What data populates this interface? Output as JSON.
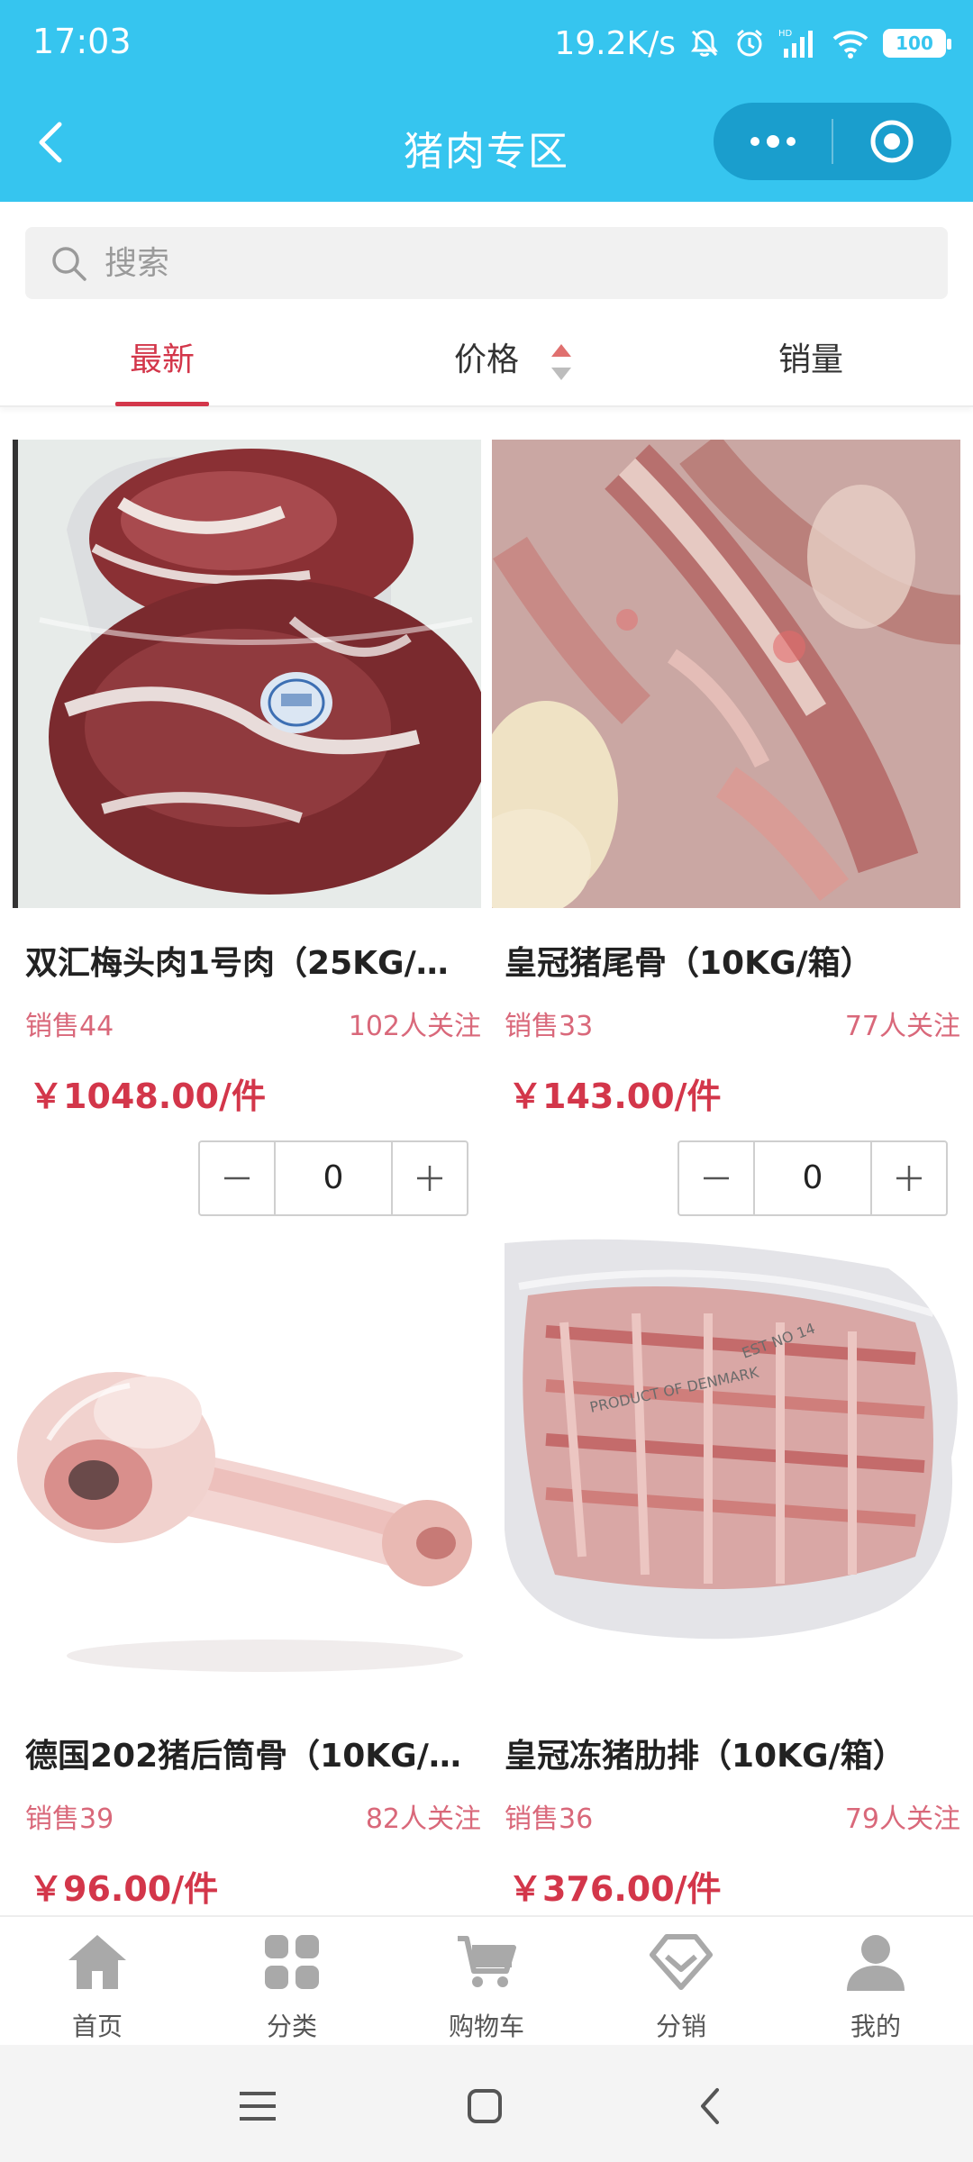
{
  "status": {
    "time": "17:03",
    "speed": "19.2K/s",
    "battery": "100"
  },
  "header": {
    "title": "猪肉专区"
  },
  "search": {
    "placeholder": "搜索"
  },
  "sort_tabs": {
    "latest": "最新",
    "price": "价格",
    "sales": "销量",
    "active": "最新"
  },
  "products": [
    {
      "name": "双汇梅头肉1号肉（25KG/…",
      "sold": "销售44",
      "followers": "102人关注",
      "price": "￥1048.00/件",
      "qty": "0"
    },
    {
      "name": "皇冠猪尾骨（10KG/箱）",
      "sold": "销售33",
      "followers": "77人关注",
      "price": "￥143.00/件",
      "qty": "0"
    },
    {
      "name": "德国202猪后筒骨（10KG/…",
      "sold": "销售39",
      "followers": "82人关注",
      "price": "￥96.00/件"
    },
    {
      "name": "皇冠冻猪肋排（10KG/箱）",
      "sold": "销售36",
      "followers": "79人关注",
      "price": "￥376.00/件"
    }
  ],
  "tabbar": {
    "home": "首页",
    "category": "分类",
    "cart": "购物车",
    "distribution": "分销",
    "mine": "我的"
  },
  "colors": {
    "header_bg": "#36c5ef",
    "accent_red": "#d3364a",
    "meta_pink": "#d9687a"
  }
}
